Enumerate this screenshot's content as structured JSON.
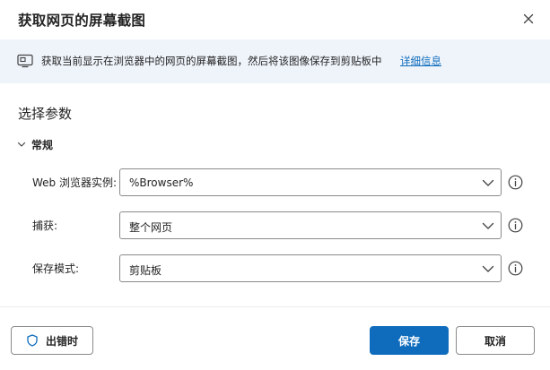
{
  "dialog": {
    "title": "获取网页的屏幕截图",
    "close_icon": "close-icon"
  },
  "info": {
    "icon": "screenshot-icon",
    "text": "获取当前显示在浏览器中的网页的屏幕截图，然后将该图像保存到剪贴板中",
    "link": "详细信息"
  },
  "params": {
    "section_title": "选择参数",
    "group_label": "常规",
    "fields": [
      {
        "label": "Web 浏览器实例:",
        "value": "%Browser%"
      },
      {
        "label": "捕获:",
        "value": "整个网页"
      },
      {
        "label": "保存模式:",
        "value": "剪贴板"
      }
    ]
  },
  "footer": {
    "on_error": "出错时",
    "save": "保存",
    "cancel": "取消"
  },
  "colors": {
    "accent": "#0f6cbd",
    "info_bg": "#eff4fb"
  }
}
